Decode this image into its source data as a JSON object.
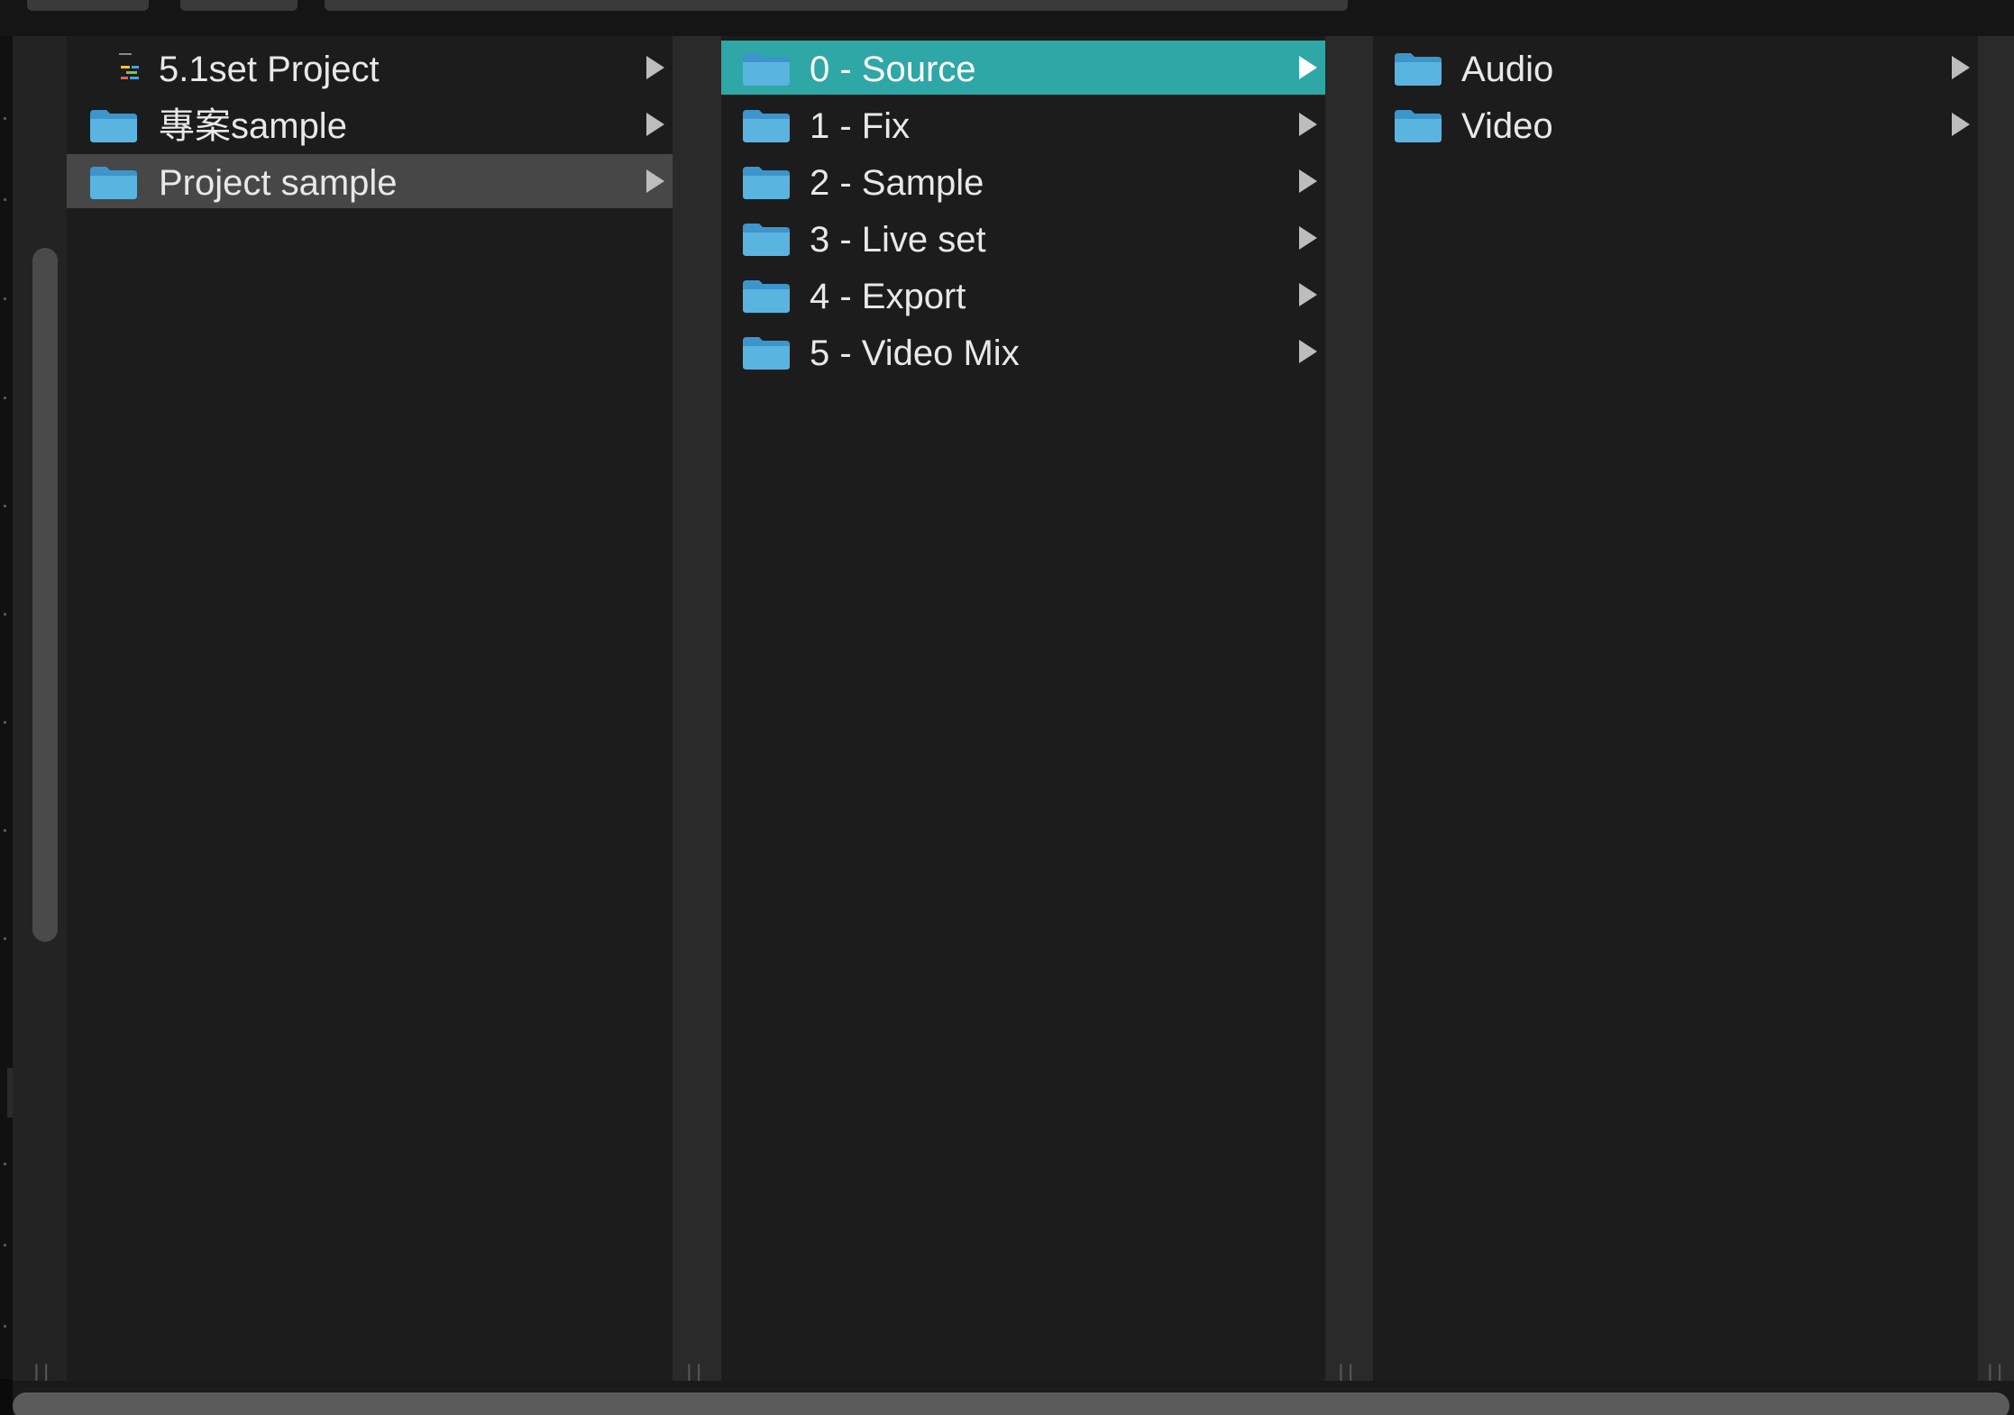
{
  "columns": [
    {
      "items": [
        {
          "label": "5.1set Project",
          "icon": "ableton-project-icon",
          "selected": false
        },
        {
          "label": "專案sample",
          "icon": "folder-icon",
          "selected": false
        },
        {
          "label": "Project sample",
          "icon": "folder-icon",
          "selected": true
        }
      ]
    },
    {
      "items": [
        {
          "label": "0 - Source",
          "icon": "folder-icon",
          "selected": true
        },
        {
          "label": "1 - Fix",
          "icon": "folder-icon",
          "selected": false
        },
        {
          "label": "2 - Sample",
          "icon": "folder-icon",
          "selected": false
        },
        {
          "label": "3 - Live set",
          "icon": "folder-icon",
          "selected": false
        },
        {
          "label": "4 - Export",
          "icon": "folder-icon",
          "selected": false
        },
        {
          "label": "5 - Video Mix",
          "icon": "folder-icon",
          "selected": false
        }
      ]
    },
    {
      "items": [
        {
          "label": "Audio",
          "icon": "folder-icon",
          "selected": false
        },
        {
          "label": "Video",
          "icon": "folder-icon",
          "selected": false
        }
      ]
    }
  ],
  "colors": {
    "selection_active": "#2fa7a6",
    "selection_inactive": "#474747",
    "folder": "#5ab4e0",
    "column_bg": "#1c1c1c"
  },
  "resizer_glyph": "||"
}
